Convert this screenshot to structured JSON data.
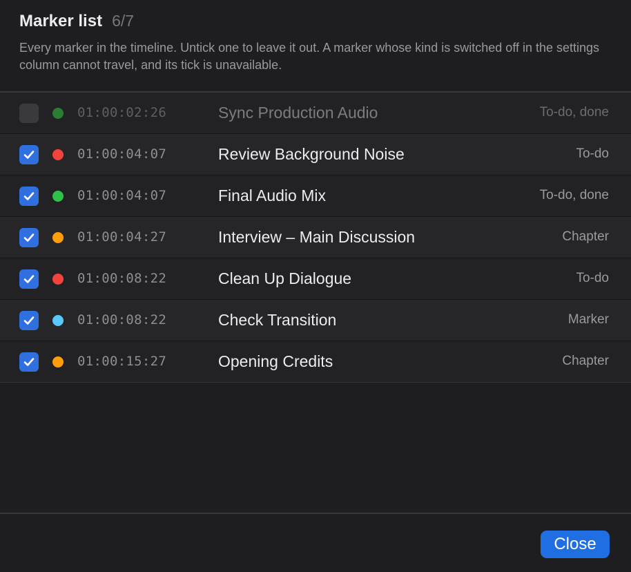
{
  "header": {
    "title": "Marker list",
    "count": "6/7",
    "description": "Every marker in the timeline. Untick one to leave it out. A marker whose kind is switched off in the settings column cannot travel, and its tick is unavailable."
  },
  "colors": {
    "green": "#2fc24a",
    "red": "#f2433d",
    "orange": "#ff9d0a",
    "blue": "#5ac8fa",
    "dim_green": "#2c7d34",
    "accent": "#2f6fe0"
  },
  "markers": [
    {
      "checked": false,
      "enabled": false,
      "color": "dim_green",
      "time": "01:00:02:26",
      "name": "Sync Production Audio",
      "kind": "To-do, done"
    },
    {
      "checked": true,
      "enabled": true,
      "color": "red",
      "time": "01:00:04:07",
      "name": "Review Background Noise",
      "kind": "To-do"
    },
    {
      "checked": true,
      "enabled": true,
      "color": "green",
      "time": "01:00:04:07",
      "name": "Final Audio Mix",
      "kind": "To-do, done"
    },
    {
      "checked": true,
      "enabled": true,
      "color": "orange",
      "time": "01:00:04:27",
      "name": "Interview – Main Discussion",
      "kind": "Chapter"
    },
    {
      "checked": true,
      "enabled": true,
      "color": "red",
      "time": "01:00:08:22",
      "name": "Clean Up Dialogue",
      "kind": "To-do"
    },
    {
      "checked": true,
      "enabled": true,
      "color": "blue",
      "time": "01:00:08:22",
      "name": "Check Transition",
      "kind": "Marker"
    },
    {
      "checked": true,
      "enabled": true,
      "color": "orange",
      "time": "01:00:15:27",
      "name": "Opening Credits",
      "kind": "Chapter"
    }
  ],
  "footer": {
    "close_label": "Close"
  }
}
